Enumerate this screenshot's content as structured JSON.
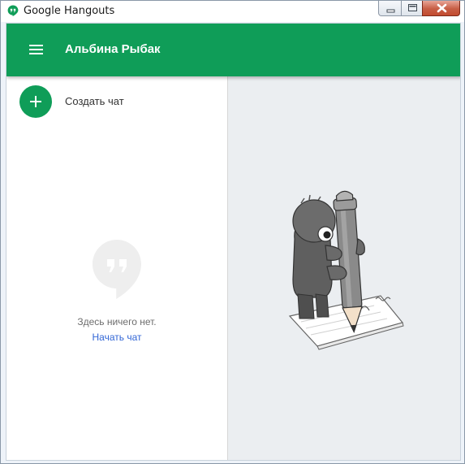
{
  "window": {
    "title": "Google Hangouts",
    "controls": [
      "minimize",
      "maximize",
      "close"
    ]
  },
  "colors": {
    "brand_green": "#0f9d58",
    "link_blue": "#3367d6",
    "panel_bg": "#ebeef1"
  },
  "header": {
    "menu_icon": "hamburger-menu-icon",
    "title": "Альбина Рыбак"
  },
  "sidebar": {
    "new_chat_icon": "plus-icon",
    "new_chat_label": "Создать чат",
    "empty_icon": "quote-bubble-icon",
    "empty_text": "Здесь ничего нет.",
    "start_chat_link": "Начать чат"
  },
  "main": {
    "illustration": "character-with-pencil-illustration"
  }
}
